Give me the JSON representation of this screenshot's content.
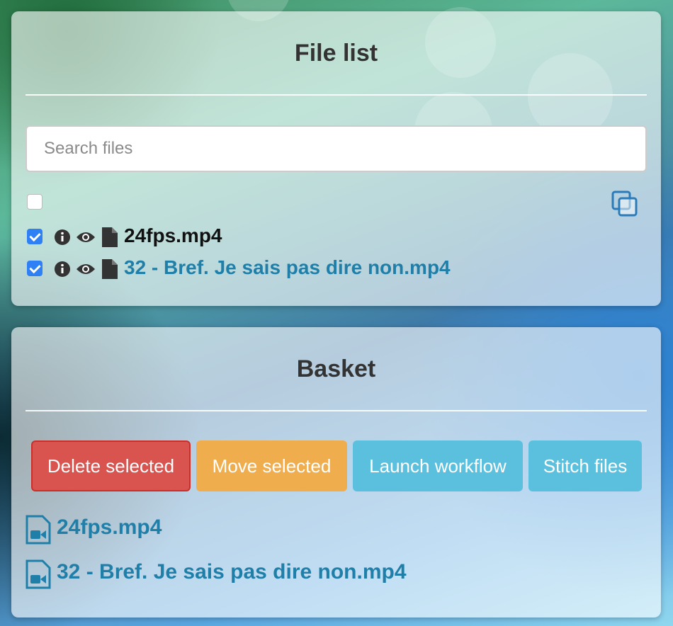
{
  "file_list": {
    "title": "File list",
    "search_placeholder": "Search files",
    "select_all_checked": false,
    "files": [
      {
        "name": "24fps.mp4",
        "checked": true,
        "color": "#111111"
      },
      {
        "name": "32 - Bref. Je sais pas dire non.mp4",
        "checked": true,
        "color": "#1f7fa8"
      }
    ],
    "icons": [
      "info-icon",
      "eye-icon",
      "file-icon",
      "copy-icon"
    ]
  },
  "basket": {
    "title": "Basket",
    "buttons": {
      "delete": "Delete selected",
      "move": "Move selected",
      "launch": "Launch workflow",
      "stitch": "Stitch files"
    },
    "items": [
      {
        "name": "24fps.mp4"
      },
      {
        "name": "32 - Bref. Je sais pas dire non.mp4"
      }
    ]
  },
  "colors": {
    "danger": "#d9534f",
    "warning": "#f0ad4e",
    "info": "#5bc0de",
    "link": "#1f7fa8",
    "checkbox": "#2f7ff5"
  }
}
